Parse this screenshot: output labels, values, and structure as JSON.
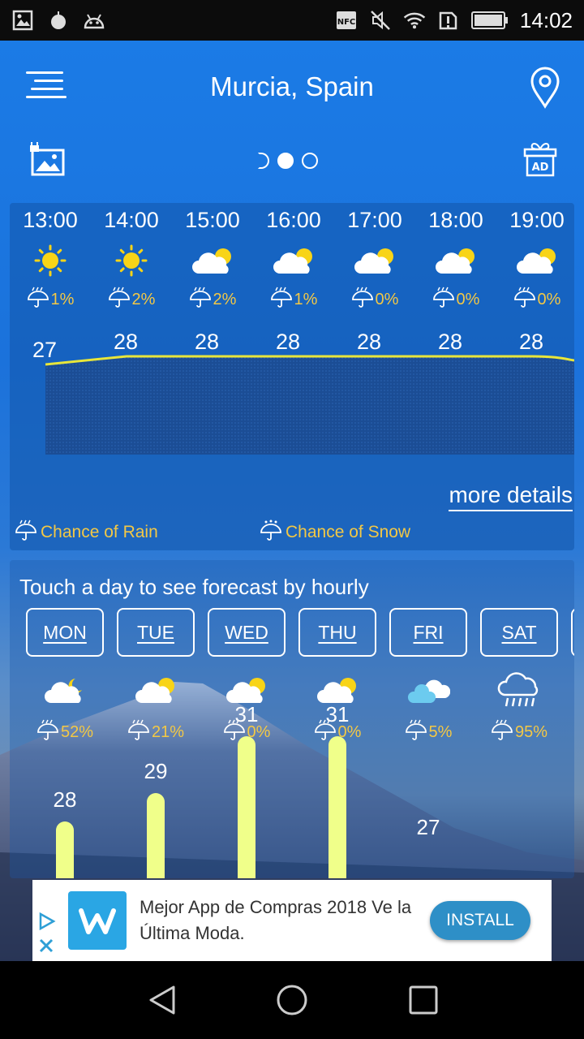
{
  "status_bar": {
    "time": "14:02",
    "left_icons": [
      "image-icon",
      "drop-icon",
      "android-icon"
    ],
    "right_icons": [
      "nfc-icon",
      "mute-icon",
      "wifi-icon",
      "sim-alert-icon",
      "battery-icon"
    ]
  },
  "header": {
    "location": "Murcia, Spain",
    "menu_icon": "menu-icon",
    "location_icon": "map-pin-icon",
    "photo_icon": "photo-lock-icon",
    "ad_icon": "gift-ad-icon",
    "ad_label": "AD",
    "pager_pages": 3,
    "pager_active": 2
  },
  "hourly": {
    "items": [
      {
        "time": "13:00",
        "icon": "sun",
        "rain": "1%",
        "temp": "27"
      },
      {
        "time": "14:00",
        "icon": "sun",
        "rain": "2%",
        "temp": "28"
      },
      {
        "time": "15:00",
        "icon": "partly-cloudy",
        "rain": "2%",
        "temp": "28"
      },
      {
        "time": "16:00",
        "icon": "partly-cloudy",
        "rain": "1%",
        "temp": "28"
      },
      {
        "time": "17:00",
        "icon": "partly-cloudy",
        "rain": "0%",
        "temp": "28"
      },
      {
        "time": "18:00",
        "icon": "partly-cloudy",
        "rain": "0%",
        "temp": "28"
      },
      {
        "time": "19:00",
        "icon": "partly-cloudy",
        "rain": "0%",
        "temp": "28"
      }
    ],
    "more_details": "more details",
    "legend_rain": "Chance of Rain",
    "legend_snow": "Chance of Snow"
  },
  "daily": {
    "title": "Touch a day to see forecast by hourly",
    "days": [
      {
        "day": "MON",
        "icon": "partly-cloudy-night",
        "rain": "52%",
        "temp": "28"
      },
      {
        "day": "TUE",
        "icon": "partly-cloudy",
        "rain": "21%",
        "temp": "29"
      },
      {
        "day": "WED",
        "icon": "partly-cloudy",
        "rain": "0%",
        "temp": "31"
      },
      {
        "day": "THU",
        "icon": "partly-cloudy",
        "rain": "0%",
        "temp": "31"
      },
      {
        "day": "FRI",
        "icon": "cloudy",
        "rain": "5%",
        "temp": "27"
      },
      {
        "day": "SAT",
        "icon": "rain",
        "rain": "95%",
        "temp": ""
      }
    ]
  },
  "ad_banner": {
    "text": "Mejor App de Compras 2018 Ve la Última Moda.",
    "install": "INSTALL",
    "logo_icon": "wish-logo-icon"
  },
  "colors": {
    "accent_yellow": "#f3c845",
    "bar_green": "#f0ff8a",
    "install_blue": "#2e8fc7",
    "sky_blue": "#1b7be6"
  }
}
